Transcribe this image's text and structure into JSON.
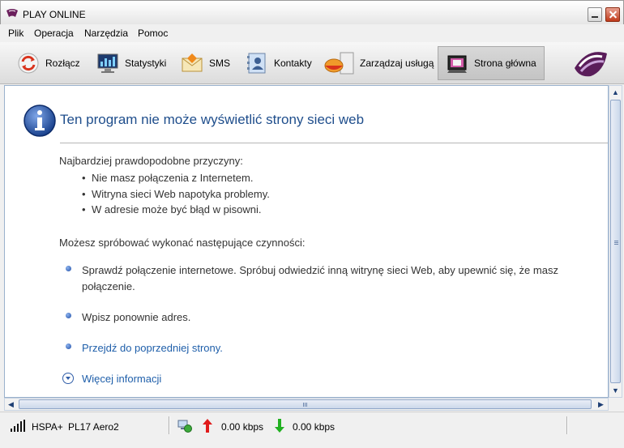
{
  "window": {
    "title": "PLAY ONLINE"
  },
  "menu": [
    "Plik",
    "Operacja",
    "Narzędzia",
    "Pomoc"
  ],
  "toolbar": {
    "disconnect": "Rozłącz",
    "statistics": "Statystyki",
    "sms": "SMS",
    "contacts": "Kontakty",
    "manage_service": "Zarządzaj usługą",
    "home": "Strona główna"
  },
  "error_page": {
    "title": "Ten program nie może wyświetlić strony sieci web",
    "causes_heading": "Najbardziej prawdopodobne przyczyny:",
    "causes": [
      "Nie masz połączenia z Internetem.",
      "Witryna sieci Web napotyka problemy.",
      "W adresie może być błąd w pisowni."
    ],
    "actions_heading": "Możesz spróbować wykonać następujące czynności:",
    "actions": [
      {
        "line1": "Sprawdź połączenie internetowe. Spróbuj odwiedzić inną witrynę sieci Web, aby upewnić się, że masz",
        "line2": "połączenie."
      },
      {
        "line1": "Wpisz ponownie adres."
      },
      {
        "line1": "Przejdź do poprzedniej strony."
      }
    ],
    "more_info": "Więcej informacji"
  },
  "status": {
    "network": "HSPA+",
    "device": "PL17 Aero2",
    "upload": "0.00 kbps",
    "download": "0.00 kbps"
  },
  "colors": {
    "link": "#1f5faa",
    "title": "#1f4e8c",
    "close": "#c03a1a"
  }
}
